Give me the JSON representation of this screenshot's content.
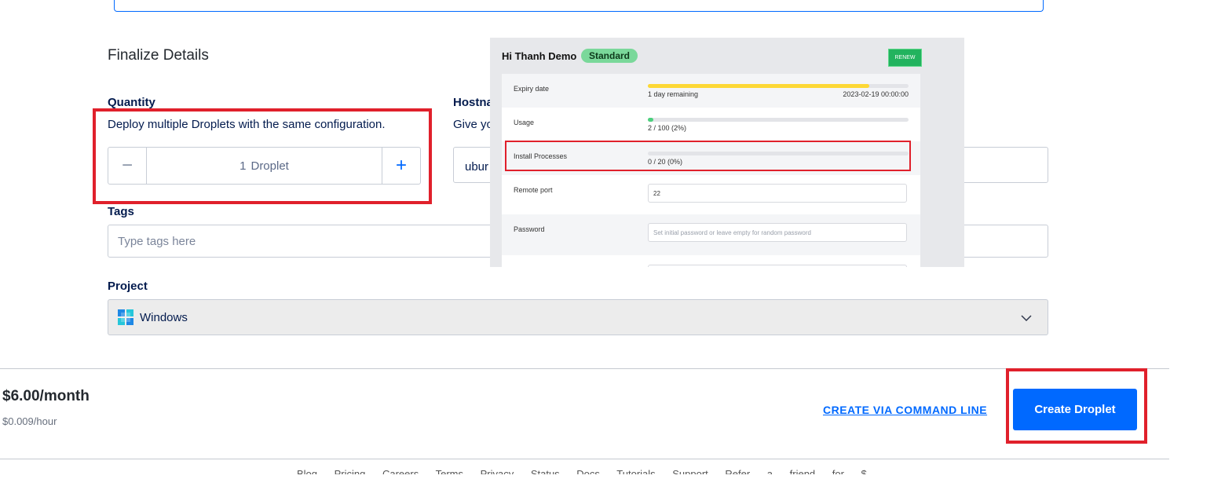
{
  "section_title": "Finalize Details",
  "quantity": {
    "label": "Quantity",
    "help": "Deploy multiple Droplets with the same configuration.",
    "minus_symbol": "−",
    "plus_symbol": "+",
    "count": "1",
    "unit": "Droplet"
  },
  "hostname": {
    "label": "Hostna",
    "help": "Give yo",
    "value": "ubur"
  },
  "tags": {
    "label": "Tags",
    "placeholder": "Type tags here"
  },
  "project": {
    "label": "Project",
    "selected": "Windows"
  },
  "summary": {
    "price": "$6.00/month",
    "price_hourly": "$0.009/hour",
    "cli_link": "CREATE VIA COMMAND LINE",
    "create_button": "Create Droplet"
  },
  "footer": {
    "links_text": "Blog Pricing Careers Terms Privacy Status Docs Tutorials Support Refer a friend for $"
  },
  "overlay": {
    "title": "Hi Thanh Demo",
    "badge": "Standard",
    "renew": "RENEW",
    "expiry": {
      "label": "Expiry date",
      "remaining": "1 day remaining",
      "date": "2023-02-19 00:00:00",
      "progress": 0.85
    },
    "usage": {
      "label": "Usage",
      "value": "2 / 100 (2%)",
      "progress": 0.02
    },
    "install": {
      "label": "Install Processes",
      "value": "0 / 20 (0%)",
      "progress": 0
    },
    "remote_port": {
      "label": "Remote port",
      "value": "22"
    },
    "password": {
      "label": "Password",
      "placeholder": "Set initial password or leave empty for random password"
    }
  },
  "colors": {
    "accent": "#0069ff",
    "highlight": "#e0202b",
    "expiry_bar": "#fdd835",
    "usage_bar": "#4cd07d"
  }
}
